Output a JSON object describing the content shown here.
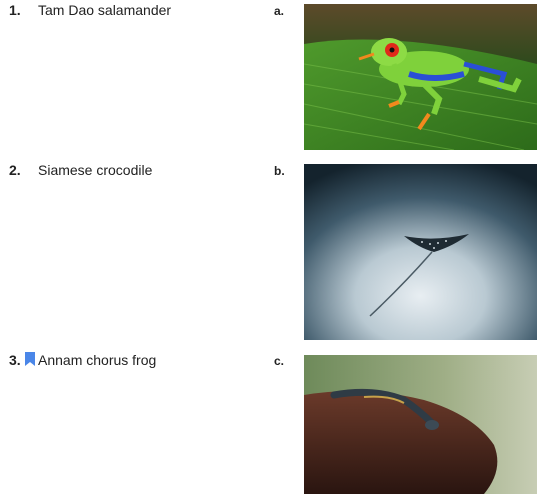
{
  "items": [
    {
      "number": "1.",
      "label": "Tam Dao salamander"
    },
    {
      "number": "2.",
      "label": "Siamese crocodile"
    },
    {
      "number": "3.",
      "label": "Annam chorus frog"
    }
  ],
  "options": [
    {
      "letter": "a.",
      "image": "red-eyed-tree-frog-photo"
    },
    {
      "letter": "b.",
      "image": "spotted-eagle-ray-photo"
    },
    {
      "letter": "c.",
      "image": "salamander-on-rock-photo"
    }
  ],
  "colors": {
    "bookmark": "#4a86e8"
  }
}
